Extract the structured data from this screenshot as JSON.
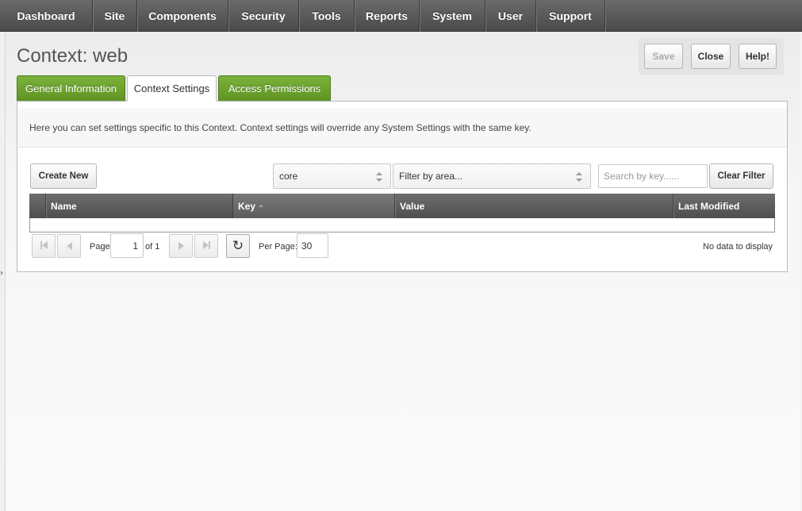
{
  "nav": {
    "items": [
      {
        "label": "Dashboard"
      },
      {
        "label": "Site"
      },
      {
        "label": "Components"
      },
      {
        "label": "Security"
      },
      {
        "label": "Tools"
      },
      {
        "label": "Reports"
      },
      {
        "label": "System"
      },
      {
        "label": "User"
      },
      {
        "label": "Support"
      }
    ]
  },
  "page": {
    "title": "Context: web"
  },
  "actions": {
    "save": "Save",
    "close": "Close",
    "help": "Help!"
  },
  "tabs": [
    {
      "label": "General Information",
      "state": "inactive"
    },
    {
      "label": "Context Settings",
      "state": "active"
    },
    {
      "label": "Access Permissions",
      "state": "inactive"
    }
  ],
  "panel": {
    "description": "Here you can set settings specific to this Context. Context settings will override any System Settings with the same key."
  },
  "toolbar": {
    "create_new": "Create New",
    "namespace_value": "core",
    "area_placeholder": "Filter by area...",
    "search_placeholder": "Search by key......",
    "clear_filter": "Clear Filter"
  },
  "grid": {
    "columns": [
      "Name",
      "Key",
      "Value",
      "Last Modified"
    ],
    "sorted_column": "Key",
    "rows": []
  },
  "paging": {
    "page_label": "Page",
    "current_page": "1",
    "of_label": "of 1",
    "per_page_label": "Per Page:",
    "per_page_value": "30",
    "status": "No data to display"
  },
  "colors": {
    "nav_bg": "#4a4a4a",
    "tab_green": "#6aa32e",
    "grid_header": "#5a5a5a"
  }
}
